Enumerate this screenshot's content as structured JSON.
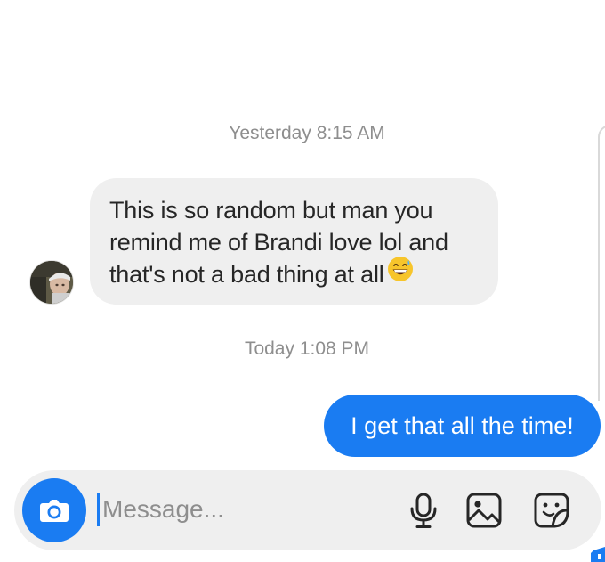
{
  "thread": {
    "timestamps": [
      "Yesterday 8:15 AM",
      "Today 1:08 PM"
    ],
    "incoming": {
      "lines": [
        "This is so random but man you",
        "remind me of Brandi love lol and",
        "that's not a bad thing at all"
      ],
      "emoji": "grinning-face-with-sweat"
    },
    "outgoing": {
      "text": "I get that all the time!"
    }
  },
  "composer": {
    "placeholder": "Message...",
    "value": ""
  },
  "colors": {
    "accent": "#1a7cf2",
    "incoming_bubble": "#efefef",
    "composer_bg": "#efefef",
    "timestamp": "#8e8e8e",
    "text": "#262626"
  },
  "icons": {
    "composer_left": "camera-icon",
    "composer_right": [
      "microphone-icon",
      "gallery-icon",
      "sticker-icon"
    ]
  }
}
